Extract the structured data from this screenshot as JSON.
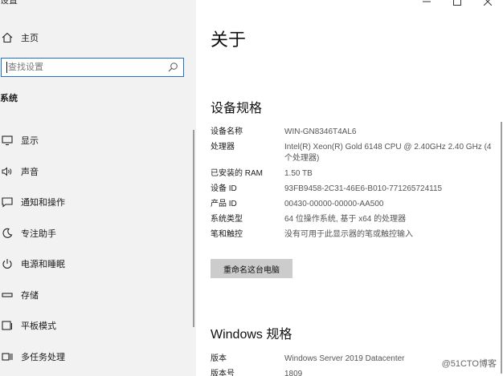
{
  "app": {
    "title": "设置"
  },
  "sidebar": {
    "home_label": "主页",
    "search_placeholder": "查找设置",
    "section_title": "系统",
    "items": [
      {
        "label": "显示",
        "icon": "monitor-icon"
      },
      {
        "label": "声音",
        "icon": "speaker-icon"
      },
      {
        "label": "通知和操作",
        "icon": "message-icon"
      },
      {
        "label": "专注助手",
        "icon": "moon-icon"
      },
      {
        "label": "电源和睡眠",
        "icon": "power-icon"
      },
      {
        "label": "存储",
        "icon": "storage-icon"
      },
      {
        "label": "平板模式",
        "icon": "tablet-icon"
      },
      {
        "label": "多任务处理",
        "icon": "multitask-icon"
      }
    ]
  },
  "main": {
    "title": "关于",
    "specs_heading": "设备规格",
    "specs": [
      {
        "key": "设备名称",
        "value": "WIN-GN8346T4AL6"
      },
      {
        "key": "处理器",
        "value": "Intel(R) Xeon(R) Gold 6148 CPU @ 2.40GHz   2.40 GHz  (4 个处理器)"
      },
      {
        "key": "已安装的 RAM",
        "value": "1.50 TB"
      },
      {
        "key": "设备 ID",
        "value": "93FB9458-2C31-46E6-B010-771265724115"
      },
      {
        "key": "产品 ID",
        "value": "00430-00000-00000-AA500"
      },
      {
        "key": "系统类型",
        "value": "64 位操作系统, 基于 x64 的处理器"
      },
      {
        "key": "笔和触控",
        "value": "没有可用于此显示器的笔或触控输入"
      }
    ],
    "rename_button": "重命名这台电脑",
    "windows_heading": "Windows 规格",
    "windows_specs": [
      {
        "key": "版本",
        "value": "Windows Server 2019 Datacenter"
      },
      {
        "key": "版本号",
        "value": "1809"
      }
    ]
  },
  "watermark": "@51CTO博客",
  "colors": {
    "sidebar_bg": "#f2f2f2",
    "search_border": "#1e6fcf",
    "button_bg": "#cccccc"
  }
}
